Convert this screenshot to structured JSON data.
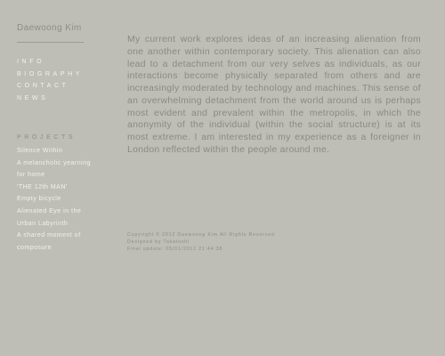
{
  "site": {
    "name": "Daewoong Kim"
  },
  "nav": {
    "items": [
      "INFO",
      "BIOGRAPHY",
      "CONTACT",
      "NEWS"
    ]
  },
  "projects": {
    "heading": "PROJECTS",
    "items": [
      "Silence Within",
      "A melancholic yearning",
      "for home",
      "'THE 12th MAN'",
      "Empty bicycle",
      "Alienated Eye in the",
      "Urban Labyrinth",
      "A shared moment of",
      "composure"
    ]
  },
  "main": {
    "statement": "My current work explores ideas of an increasing alienation from one another within contemporary society. This alienation can also lead to a detachment from our very selves as individuals, as our interactions become physically separated from others and are increasingly moderated by technology and machines. This sense of an overwhelming detachment from the world around us is perhaps most evident and prevalent within the metropolis, in which the anonymity of the individual (within the social structure) is at its most extreme. I am interested in my experience as a foreigner in London reflected within the people around me."
  },
  "footer": {
    "copyright": "Copyright © 2012 Daewoong Kim All Rights Reserved",
    "designed_by": "Designed by Takatoshi",
    "last_update": "Final update: 05/01/2012 21:44:38"
  }
}
